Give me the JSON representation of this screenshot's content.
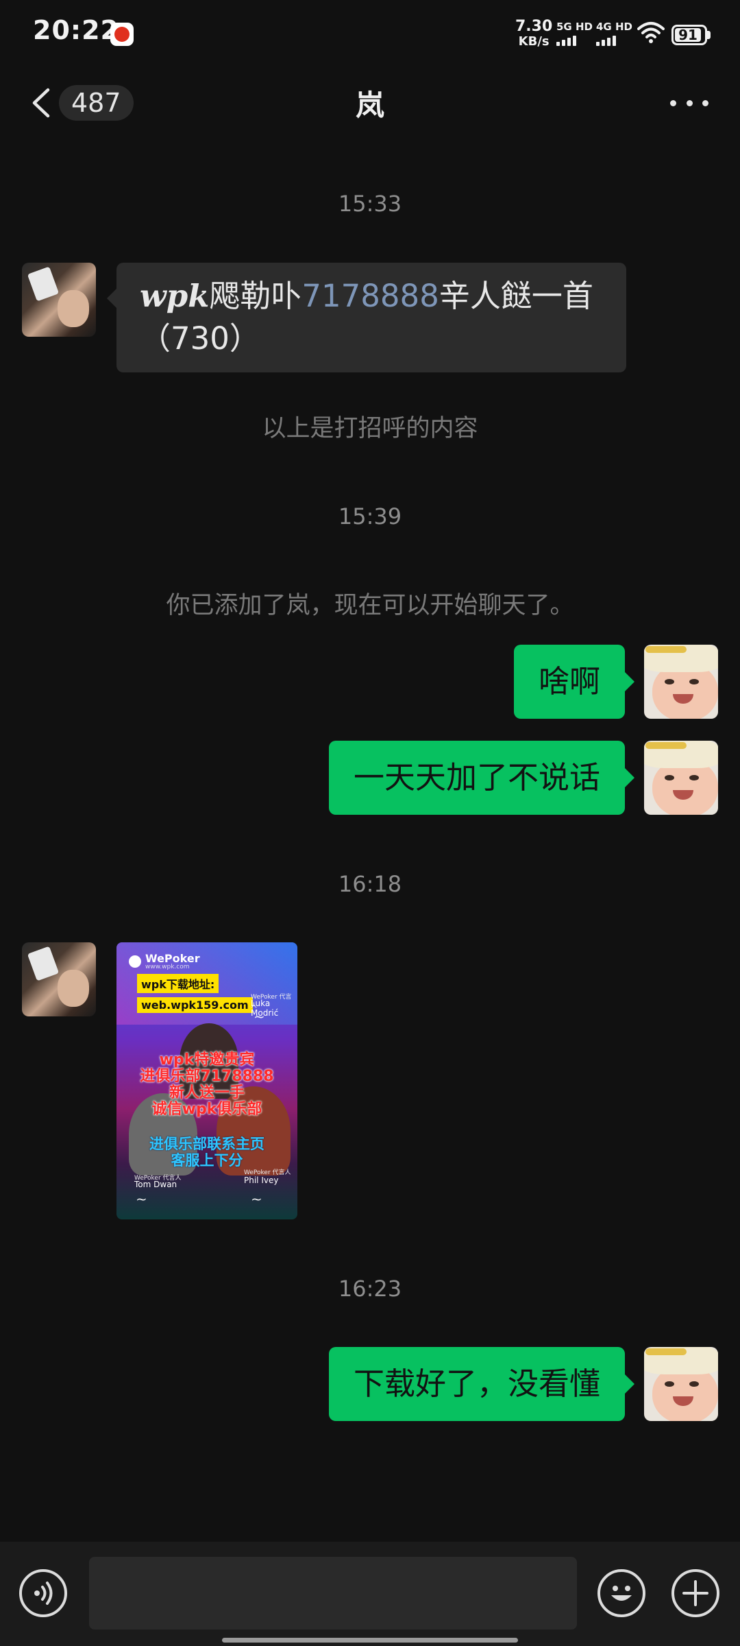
{
  "status_bar": {
    "time": "20:22",
    "net_speed_value": "7.30",
    "net_speed_unit": "KB/s",
    "sim1_label": "5G HD",
    "sim2_label": "4G HD",
    "battery": "91",
    "app_notification_icon": "red-app-icon",
    "wifi_icon": "wifi-icon"
  },
  "header": {
    "back_icon": "chevron-left-icon",
    "unread_count": "487",
    "title": "岚",
    "more_icon": "more-dots-icon"
  },
  "messages": [
    {
      "type": "time",
      "text": "15:33"
    },
    {
      "type": "incoming_text",
      "parts": [
        "wpk",
        "飔勒卟",
        "7178888",
        "辛人餸一首",
        "（730）"
      ]
    },
    {
      "type": "system",
      "text": "以上是打招呼的内容"
    },
    {
      "type": "time",
      "text": "15:39"
    },
    {
      "type": "system",
      "text": "你已添加了岚，现在可以开始聊天了。"
    },
    {
      "type": "outgoing_text",
      "text": "啥啊"
    },
    {
      "type": "outgoing_text",
      "text": "一天天加了不说话"
    },
    {
      "type": "time",
      "text": "16:18"
    },
    {
      "type": "incoming_image",
      "image": {
        "brand": "WePoker",
        "brand_sub": "www.wpk.com",
        "tag_download": "wpk下载地址:",
        "tag_url": "web.wpk159.com",
        "red_lines": [
          "wpk特邀贵宾",
          "进俱乐部7178888",
          "新人送一手",
          "诚信wpk俱乐部"
        ],
        "blue_lines": [
          "进俱乐部联系主页",
          "客服上下分"
        ],
        "person_top": "Luka Modrić",
        "person_left": "Tom Dwan",
        "person_right": "Phil Ivey",
        "caption_top": "WePoker 代言人",
        "caption_left": "WePoker 代言人",
        "caption_right": "WePoker 代言人"
      }
    },
    {
      "type": "time",
      "text": "16:23"
    },
    {
      "type": "outgoing_text",
      "text": "下载好了，没看懂"
    }
  ],
  "input_bar": {
    "voice_icon": "voice-icon",
    "input_value": "",
    "emoji_icon": "emoji-icon",
    "plus_icon": "plus-icon"
  },
  "colors": {
    "background": "#111111",
    "incoming_bubble": "#2c2c2c",
    "outgoing_bubble": "#07c160",
    "link_digits": "#7e96b8"
  }
}
